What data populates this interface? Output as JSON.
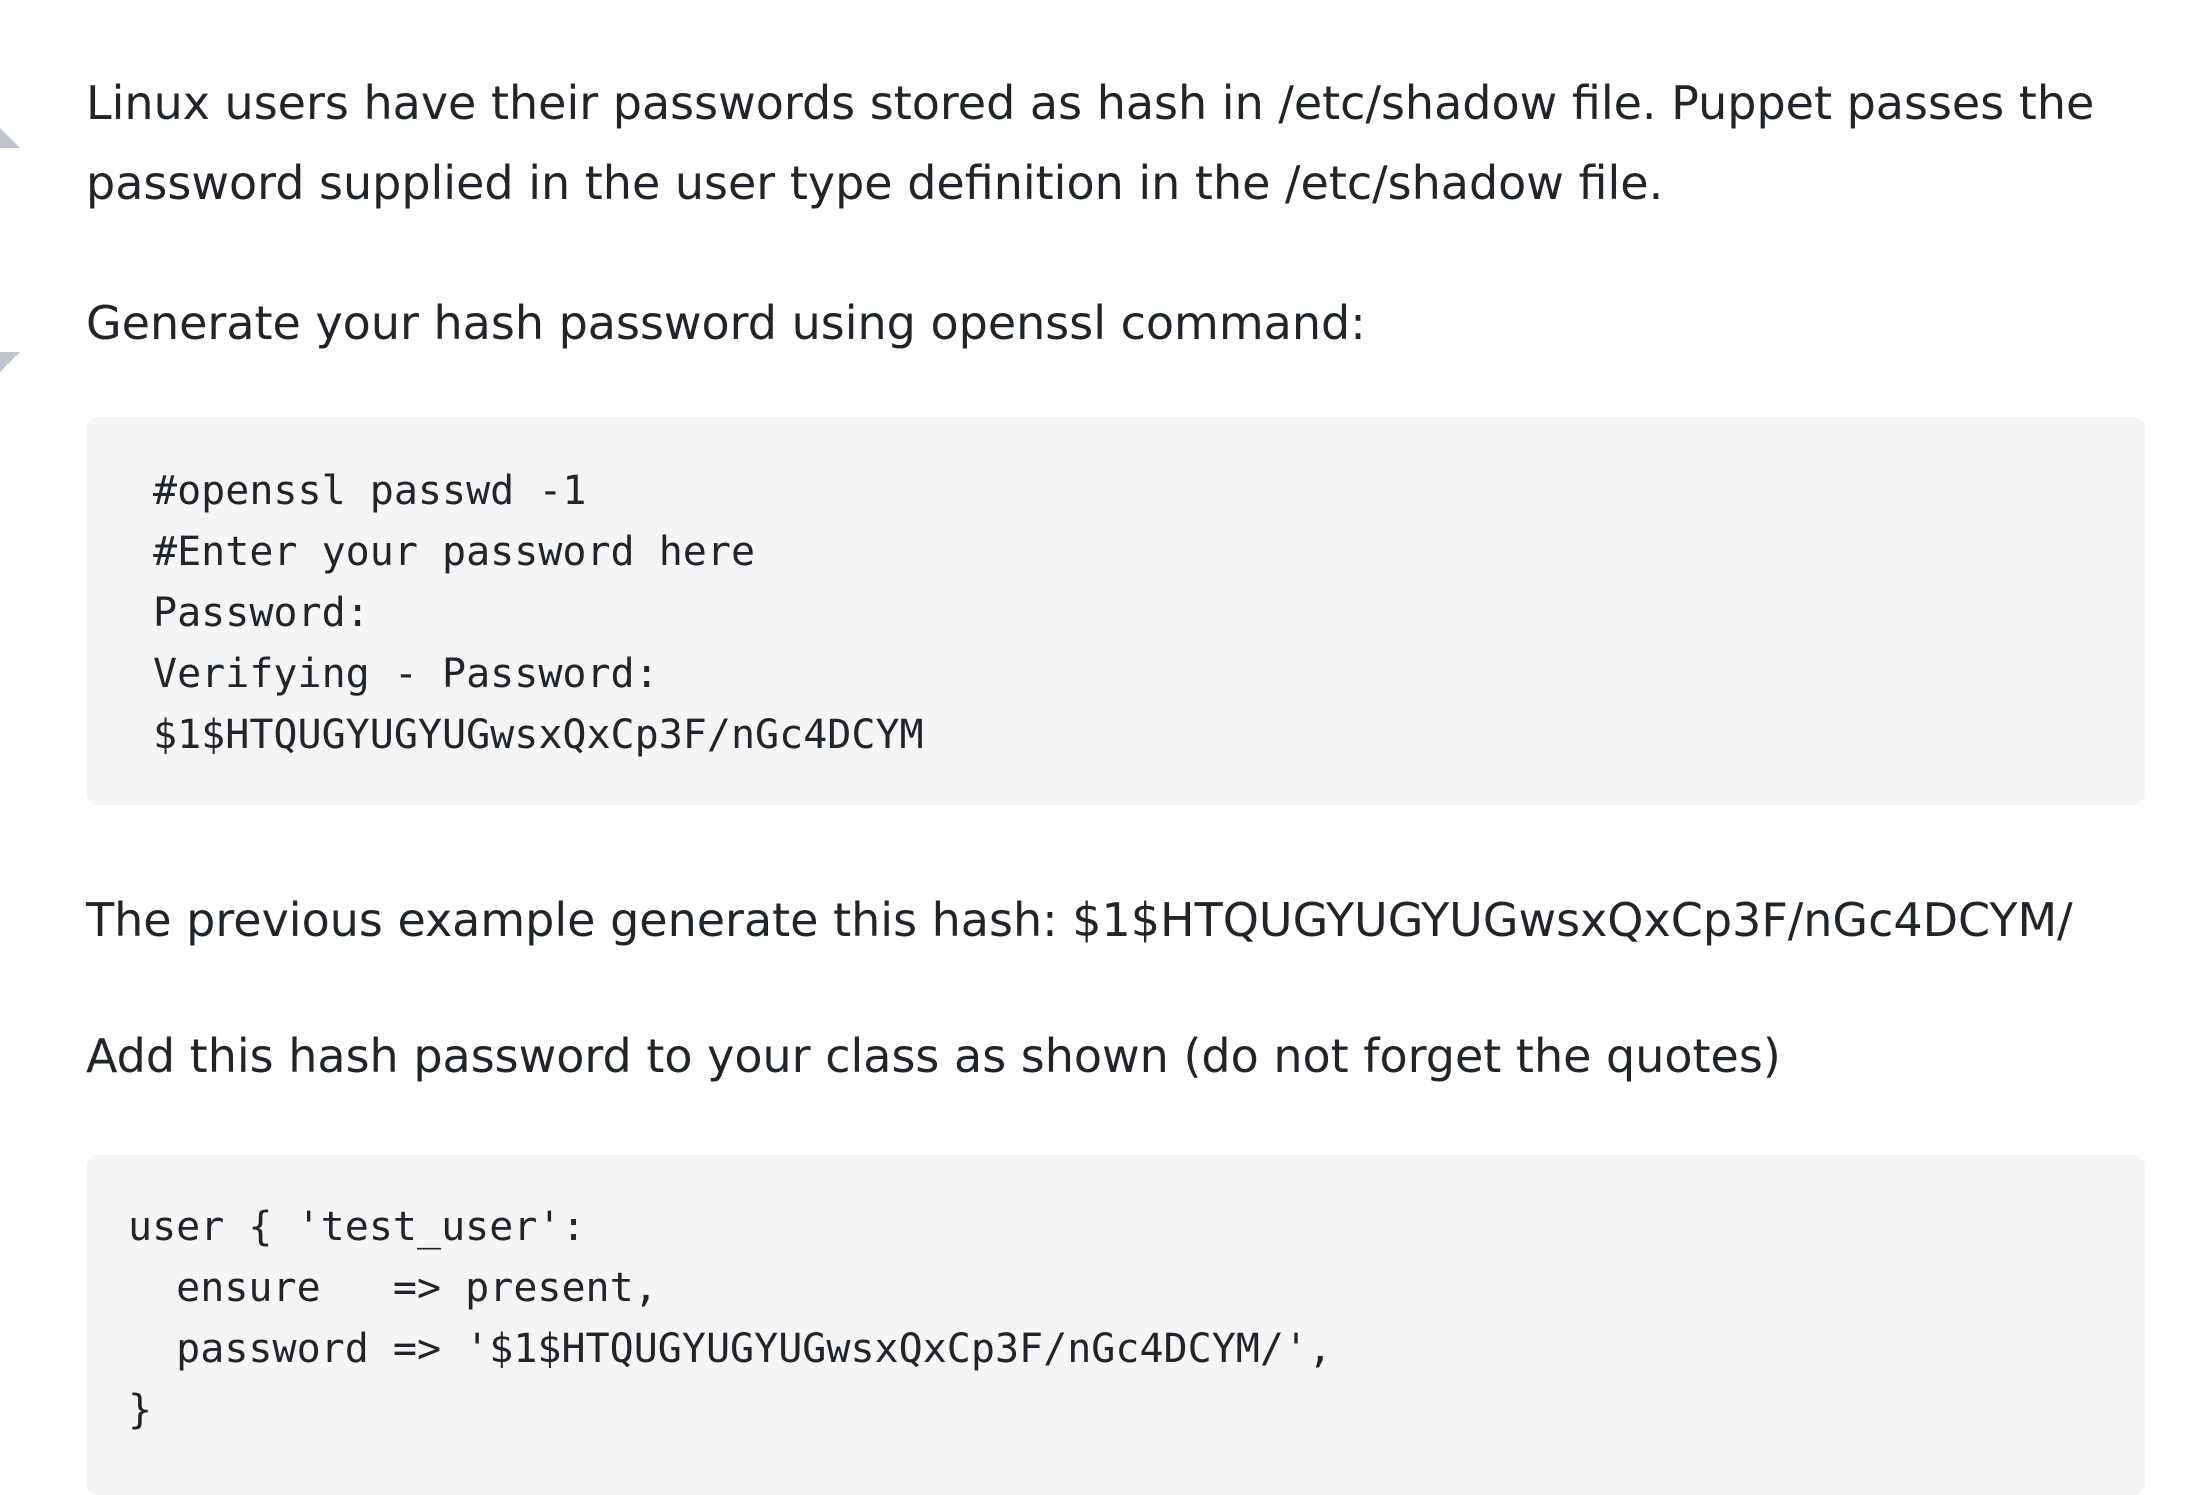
{
  "paragraphs": [
    "Linux users have their passwords stored as hash in /etc/shadow file. Puppet passes the password supplied in the user type definition in the /etc/shadow file.",
    "Generate your hash password using openssl command:",
    "The previous example generate this hash: $1$HTQUGYUGYUGwsxQxCp3F/nGc4DCYM/",
    "Add this hash password to your class as shown (do not forget the quotes)"
  ],
  "code_blocks": [
    [
      "#openssl passwd -1",
      "#Enter your password here",
      "Password:",
      "Verifying - Password:",
      "$1$HTQUGYUGYUGwsxQxCp3F/nGc4DCYM"
    ],
    [
      "user { 'test_user':",
      "  ensure   => present,",
      "  password => '$1$HTQUGYUGYUGwsxQxCp3F/nGc4DCYM/',",
      "}"
    ]
  ]
}
